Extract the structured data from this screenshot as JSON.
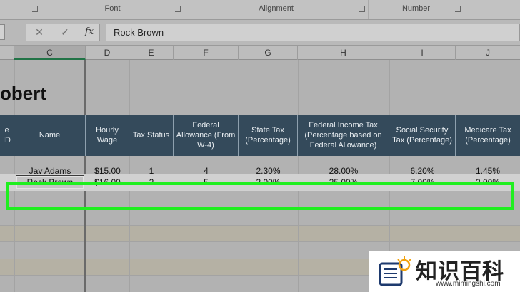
{
  "ribbon": {
    "groups": [
      {
        "label": "Font"
      },
      {
        "label": "Alignment"
      },
      {
        "label": "Number"
      }
    ]
  },
  "formula_bar": {
    "cancel_icon": "close-icon",
    "enter_icon": "check-icon",
    "fx_label": "fx",
    "content": "Rock Brown"
  },
  "columns": [
    {
      "label": "C"
    },
    {
      "label": "D"
    },
    {
      "label": "E"
    },
    {
      "label": "F"
    },
    {
      "label": "G"
    },
    {
      "label": "H"
    },
    {
      "label": "I"
    },
    {
      "label": "J"
    }
  ],
  "active_column": "C",
  "sheet_title": "obert",
  "headers": [
    {
      "label": "e ID"
    },
    {
      "label": "Name"
    },
    {
      "label": "Hourly Wage"
    },
    {
      "label": "Tax Status"
    },
    {
      "label": "Federal Allowance (From W-4)"
    },
    {
      "label": "State Tax (Percentage)"
    },
    {
      "label": "Federal Income Tax (Percentage based on Federal Allowance)"
    },
    {
      "label": "Social Security Tax (Percentage)"
    },
    {
      "label": "Medicare Tax (Percentage)"
    }
  ],
  "rows": [
    {
      "cells": [
        "Jay Adams",
        "$15.00",
        "1",
        "4",
        "2.30%",
        "28.00%",
        "6.20%",
        "1.45%"
      ]
    },
    {
      "cells": [
        "Rock Brown",
        "$16.00",
        "2",
        "5",
        "3.00%",
        "25.00%",
        "7.00%",
        "2.00%"
      ]
    }
  ],
  "selected_cell": "C",
  "highlight_color": "#1fef1f",
  "header_color": "#344a5b",
  "watermark": {
    "brand": "知识百科",
    "url": "www.mimingshi.com"
  }
}
